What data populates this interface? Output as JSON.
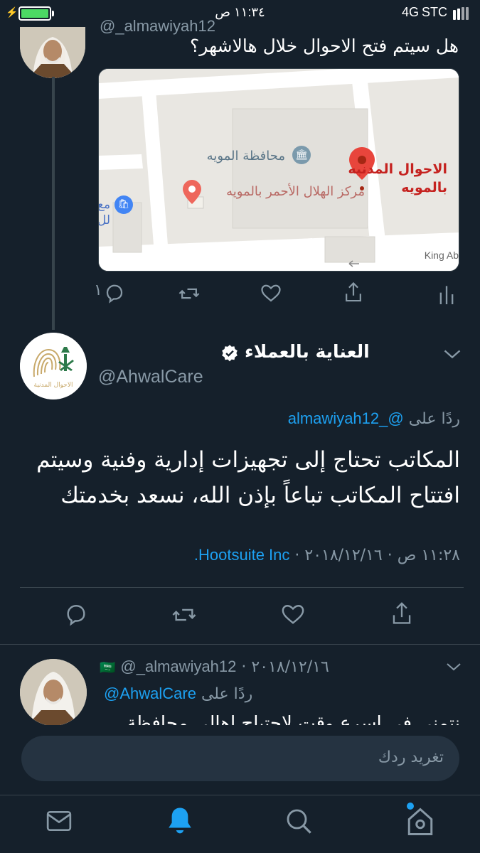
{
  "status_bar": {
    "time": "١١:٣٤ ص",
    "network": "4G",
    "carrier": "STC"
  },
  "parent_tweet": {
    "handle_partial": "@_almawiyah12",
    "text": "هل سيتم فتح الاحوال خلال هالاشهر؟",
    "map": {
      "pin_main_label_line1": "الاحوال المدنيه",
      "pin_main_label_line2": "بالمويه",
      "poi_governorate": "محافظة المويه",
      "poi_red_crescent": "مركز الهلال الأحمر بالمويه",
      "poi_edge_line1": "مع",
      "poi_edge_line2": "لل",
      "road_label": "King Ab"
    },
    "actions": {
      "reply_count": "١"
    }
  },
  "main_tweet": {
    "display_name": "العناية بالعملاء",
    "handle": "@AhwalCare",
    "reply_prefix": "ردًا على",
    "reply_to": "@_almawiyah12",
    "text_line1": "المكاتب تحتاج إلى تجهيزات إدارية وفنية وسيتم",
    "text_line2": "افتتاح المكاتب تباعاً بإذن الله، نسعد بخدمتك",
    "meta_time": "١١:٢٨ ص · ٢٠١٨/١٢/١٦ · ",
    "meta_source": "Hootsuite Inc."
  },
  "reply_tweet": {
    "flag": "🇸🇦",
    "handle": "@_almawiyah12",
    "date": " · ٢٠١٨/١٢/١٦",
    "reply_prefix": "ردًا على",
    "reply_to": "@AhwalCare",
    "text_partial": "نتمنى في اسرع وقت لاحتياج اهالي محافظة"
  },
  "reply_input": {
    "placeholder": "تغريد ردك"
  },
  "tabbar": {
    "items": [
      "messages",
      "notifications",
      "search",
      "home"
    ]
  },
  "colors": {
    "background": "#15202b",
    "accent": "#1da1f2",
    "muted": "#8899a6",
    "divider": "#38444d",
    "battery": "#4cd964"
  },
  "icons": {
    "verified": "verified-badge-icon",
    "chevron": "chevron-down-icon",
    "reply": "reply-icon",
    "retweet": "retweet-icon",
    "like": "heart-icon",
    "share": "share-icon",
    "analytics": "analytics-icon"
  }
}
